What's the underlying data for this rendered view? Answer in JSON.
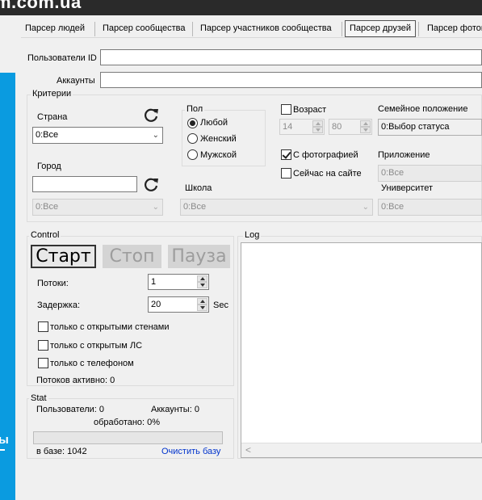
{
  "topbar": {
    "title": "m.com.ua"
  },
  "left_strip": {
    "label": "ы"
  },
  "tabs": [
    {
      "label": "Парсер людей",
      "active": false
    },
    {
      "label": "Парсер сообщества",
      "active": false
    },
    {
      "label": "Парсер участников сообщества",
      "active": false
    },
    {
      "label": "Парсер друзей",
      "active": true
    },
    {
      "label": "Парсер фотог",
      "active": false
    }
  ],
  "form": {
    "users_id_label": "Пользователи ID",
    "users_id_value": "",
    "accounts_label": "Аккаунты",
    "accounts_value": ""
  },
  "criteria": {
    "title": "Критерии",
    "country_label": "Страна",
    "country_value": "0:Все",
    "city_label": "Город",
    "city_input_value": "",
    "city_value": "0:Все",
    "gender": {
      "title": "Пол",
      "options": [
        {
          "label": "Любой",
          "checked": true
        },
        {
          "label": "Женский",
          "checked": false
        },
        {
          "label": "Мужской",
          "checked": false
        }
      ]
    },
    "school_label": "Школа",
    "school_value": "0:Все",
    "age_label": "Возраст",
    "age_checked": false,
    "age_from": "14",
    "age_to": "80",
    "with_photo_label": "С фотографией",
    "with_photo_checked": true,
    "online_label": "Сейчас на сайте",
    "online_checked": false,
    "family_label": "Семейное положение",
    "family_value": "0:Выбор статуса",
    "app_label": "Приложение",
    "app_value": "0:Все",
    "university_label": "Университет",
    "university_value": "0:Все"
  },
  "control": {
    "title": "Control",
    "start_label": "Старт",
    "stop_label": "Стоп",
    "pause_label": "Пауза",
    "threads_label": "Потоки:",
    "threads_value": "1",
    "delay_label": "Задержка:",
    "delay_value": "20",
    "delay_unit": "Sec",
    "open_walls_label": "только с открытыми стенами",
    "open_pm_label": "только с открытым ЛС",
    "phone_label": "только с телефоном",
    "active_threads": "Потоков активно: 0"
  },
  "log": {
    "title": "Log",
    "scroll_left": "<"
  },
  "stat": {
    "title": "Stat",
    "users": "Пользователи: 0",
    "accounts": "Аккаунты: 0",
    "processed": "обработано: 0%",
    "progress": 0,
    "in_base": "в базе: 1042",
    "clear_base": "Очистить базу"
  }
}
